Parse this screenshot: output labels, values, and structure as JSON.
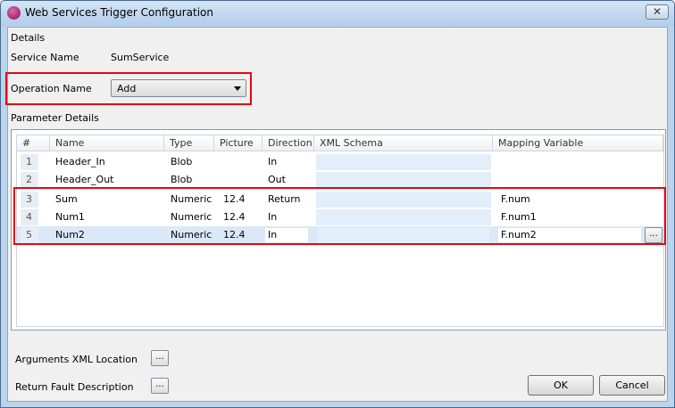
{
  "window": {
    "title": "Web Services Trigger Configuration",
    "close_glyph": "✕"
  },
  "details": {
    "section_label": "Details",
    "service_name_label": "Service Name",
    "service_name_value": "SumService",
    "operation_name_label": "Operation Name",
    "operation_name_value": "Add"
  },
  "parameters": {
    "section_label": "Parameter Details",
    "columns": [
      "#",
      "Name",
      "Type",
      "Picture",
      "Direction",
      "XML Schema",
      "Mapping Variable"
    ],
    "rows": [
      {
        "num": "1",
        "name": "Header_In",
        "type": "Blob",
        "picture": "",
        "direction": "In",
        "schema": "",
        "mapping": ""
      },
      {
        "num": "2",
        "name": "Header_Out",
        "type": "Blob",
        "picture": "",
        "direction": "Out",
        "schema": "",
        "mapping": ""
      },
      {
        "num": "3",
        "name": "Sum",
        "type": "Numeric",
        "picture": "12.4",
        "direction": "Return",
        "schema": "",
        "mapping": "F.num"
      },
      {
        "num": "4",
        "name": "Num1",
        "type": "Numeric",
        "picture": "12.4",
        "direction": "In",
        "schema": "",
        "mapping": "F.num1"
      },
      {
        "num": "5",
        "name": "Num2",
        "type": "Numeric",
        "picture": "12.4",
        "direction": "In",
        "schema": "",
        "mapping": "F.num2"
      }
    ],
    "selected_row": "5",
    "ellipsis_label": "..."
  },
  "footer": {
    "arguments_xml_label": "Arguments XML Location",
    "return_fault_label": "Return Fault Description",
    "ellipsis_label": "...",
    "ok_label": "OK",
    "cancel_label": "Cancel"
  },
  "colors": {
    "highlight": "#e30613",
    "selected_row": "#dbe8f7",
    "title_bar": "#c2d8ef"
  },
  "icons": {
    "app": "magic-app-icon",
    "close": "close-icon",
    "dropdown": "chevron-down-icon"
  }
}
